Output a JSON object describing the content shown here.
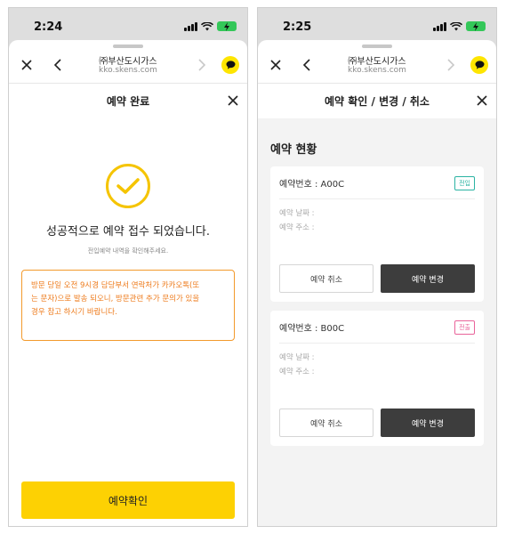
{
  "colors": {
    "accent_yellow": "#fdd103",
    "notice_orange": "#ee7b1c",
    "dark_button": "#3d3d3d",
    "badge_teal": "#2bb3a3",
    "badge_pink": "#e9639a",
    "battery_green": "#34c759"
  },
  "screen1": {
    "status": {
      "time": "2:24"
    },
    "browser": {
      "title": "㈜부산도시가스",
      "url": "kko.skens.com"
    },
    "modal": {
      "title": "예약 완료"
    },
    "success_message": "성공적으로 예약 접수 되었습니다.",
    "sub_message": "전입예약 내역을 확인해주세요.",
    "notice_lines": [
      "방문 당일 오전 9시경 담당부서 연락처가 카카오톡(또",
      "는 문자)으로 발송 되오니, 방문관련 추가 문의가 있을",
      "경우 참고 하시기 바랍니다."
    ],
    "confirm_button": "예약확인"
  },
  "screen2": {
    "status": {
      "time": "2:25"
    },
    "browser": {
      "title": "㈜부산도시가스",
      "url": "kko.skens.com"
    },
    "modal": {
      "title": "예약 확인 / 변경 / 취소"
    },
    "section_title": "예약 현황",
    "cards": [
      {
        "number_label": "예약번호 : A00C",
        "badge": "전입",
        "date_label": "예약 날짜 :",
        "address_label": "예약 주소 :",
        "cancel_label": "예약 취소",
        "change_label": "예약 변경"
      },
      {
        "number_label": "예약번호 : B00C",
        "badge": "전출",
        "date_label": "예약 날짜 :",
        "address_label": "예약 주소 :",
        "cancel_label": "예약 취소",
        "change_label": "예약 변경"
      }
    ]
  },
  "icons": [
    "close-icon",
    "back-chevron-icon",
    "forward-chevron-icon",
    "kakaotalk-icon",
    "check-icon",
    "signal-icon",
    "wifi-icon",
    "battery-charging-icon"
  ]
}
